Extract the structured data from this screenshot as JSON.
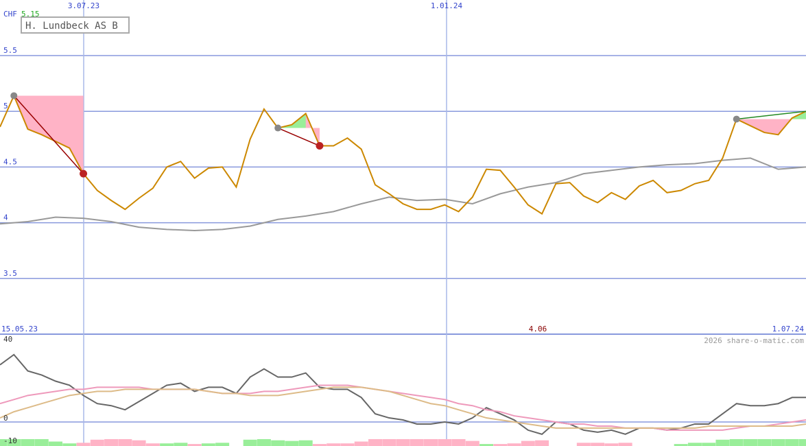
{
  "chart_data": [
    {
      "type": "line",
      "title": "H. Lundbeck AS B",
      "currency": "CHF",
      "last_value_label": "5.15",
      "y_ticks": [
        "5.5",
        "5",
        "4.5",
        "4",
        "3.5"
      ],
      "y_tick_values": [
        5.5,
        5.0,
        4.5,
        4.0,
        3.5
      ],
      "ylim": [
        3.0,
        5.5
      ],
      "top_date_labels": [
        "3.07.23",
        "1.01.24"
      ],
      "bottom_date_labels": [
        "15.05.23",
        "1.07.24"
      ],
      "bottom_center_label": "4.06",
      "watermark": "2026 share-o-matic.com",
      "series": [
        {
          "role": "price",
          "color": "#cc8800",
          "x": [
            0,
            1,
            2,
            3,
            4,
            5,
            6,
            7,
            8,
            9,
            10,
            11,
            12,
            13,
            14,
            15,
            16,
            17,
            18,
            19,
            20,
            21,
            22,
            23,
            24,
            25,
            26,
            27,
            28,
            29,
            30,
            31,
            32,
            33,
            34,
            35,
            36,
            37,
            38,
            39,
            40,
            41,
            42,
            43,
            44,
            45,
            46,
            47,
            48,
            49,
            50,
            51,
            52,
            53,
            54,
            55,
            56,
            57,
            58
          ],
          "values": [
            4.86,
            5.14,
            4.84,
            4.79,
            4.73,
            4.67,
            4.44,
            4.29,
            4.2,
            4.12,
            4.22,
            4.31,
            4.5,
            4.55,
            4.4,
            4.49,
            4.5,
            4.32,
            4.75,
            5.02,
            4.85,
            4.88,
            4.98,
            4.69,
            4.69,
            4.76,
            4.66,
            4.34,
            4.26,
            4.17,
            4.12,
            4.12,
            4.16,
            4.1,
            4.23,
            4.48,
            4.47,
            4.32,
            4.16,
            4.08,
            4.35,
            4.36,
            4.24,
            4.18,
            4.27,
            4.21,
            4.33,
            4.38,
            4.27,
            4.29,
            4.35,
            4.38,
            4.58,
            4.93,
            4.87,
            4.81,
            4.79,
            4.94,
            5.0
          ]
        },
        {
          "role": "moving-average",
          "color": "#999999",
          "x": [
            0,
            2,
            4,
            6,
            8,
            10,
            12,
            14,
            16,
            18,
            20,
            22,
            24,
            26,
            28,
            30,
            32,
            34,
            36,
            38,
            40,
            42,
            44,
            46,
            48,
            50,
            52,
            54,
            56,
            58
          ],
          "values": [
            3.99,
            4.01,
            4.05,
            4.04,
            4.01,
            3.96,
            3.94,
            3.93,
            3.94,
            3.97,
            4.03,
            4.06,
            4.1,
            4.17,
            4.23,
            4.2,
            4.21,
            4.17,
            4.26,
            4.32,
            4.36,
            4.44,
            4.47,
            4.5,
            4.52,
            4.53,
            4.56,
            4.58,
            4.48,
            4.5
          ]
        }
      ],
      "annotations": [
        {
          "type": "trade",
          "from_x": 1,
          "from_value": 5.14,
          "to_x": 6,
          "to_value": 4.44,
          "color": "#990000"
        },
        {
          "type": "trade",
          "from_x": 20,
          "from_value": 4.85,
          "to_x": 23,
          "to_value": 4.69,
          "color": "#990000"
        },
        {
          "type": "trade",
          "from_x": 53,
          "from_value": 4.93,
          "to_x": 58,
          "to_value": 5.0,
          "color": "#228822"
        }
      ]
    },
    {
      "type": "line",
      "role": "indicator",
      "y_ticks": [
        "40",
        "0",
        "-10"
      ],
      "y_tick_values": [
        40,
        0,
        -10
      ],
      "ylim": [
        -10,
        40
      ],
      "series": [
        {
          "color": "#666666",
          "values": [
            28,
            33,
            25,
            23,
            20,
            18,
            13,
            9,
            8,
            6,
            10,
            14,
            18,
            19,
            15,
            17,
            17,
            14,
            22,
            26,
            22,
            22,
            24,
            17,
            16,
            16,
            12,
            4,
            2,
            1,
            -1,
            -1,
            0,
            -1,
            2,
            7,
            4,
            1,
            -4,
            -6,
            0,
            -1,
            -4,
            -5,
            -4,
            -6,
            -3,
            -3,
            -4,
            -3,
            -1,
            -1,
            4,
            9,
            8,
            8,
            9,
            12,
            12
          ]
        },
        {
          "color": "#ee99bb",
          "values": [
            9,
            11,
            13,
            14,
            15,
            16,
            16,
            17,
            17,
            17,
            17,
            16,
            16,
            16,
            16,
            15,
            14,
            14,
            14,
            15,
            15,
            16,
            17,
            18,
            18,
            18,
            17,
            16,
            15,
            14,
            13,
            12,
            11,
            9,
            8,
            6,
            5,
            3,
            2,
            1,
            0,
            -1,
            -1,
            -2,
            -2,
            -3,
            -3,
            -3,
            -4,
            -4,
            -4,
            -4,
            -4,
            -3,
            -2,
            -2,
            -1,
            0,
            1
          ]
        },
        {
          "color": "#ddbb88",
          "values": [
            2,
            5,
            7,
            9,
            11,
            13,
            14,
            15,
            15,
            16,
            16,
            16,
            16,
            16,
            16,
            15,
            14,
            14,
            13,
            13,
            13,
            14,
            15,
            16,
            17,
            17,
            17,
            16,
            15,
            13,
            11,
            9,
            8,
            6,
            4,
            2,
            1,
            0,
            -1,
            -2,
            -3,
            -3,
            -3,
            -3,
            -3,
            -3,
            -3,
            -3,
            -3,
            -3,
            -3,
            -2,
            -2,
            -2,
            -2,
            -2,
            -2,
            -2,
            -1
          ]
        }
      ],
      "histogram_colors": {
        "positive": "#ffb3c6",
        "negative": "#99ee99"
      }
    }
  ]
}
